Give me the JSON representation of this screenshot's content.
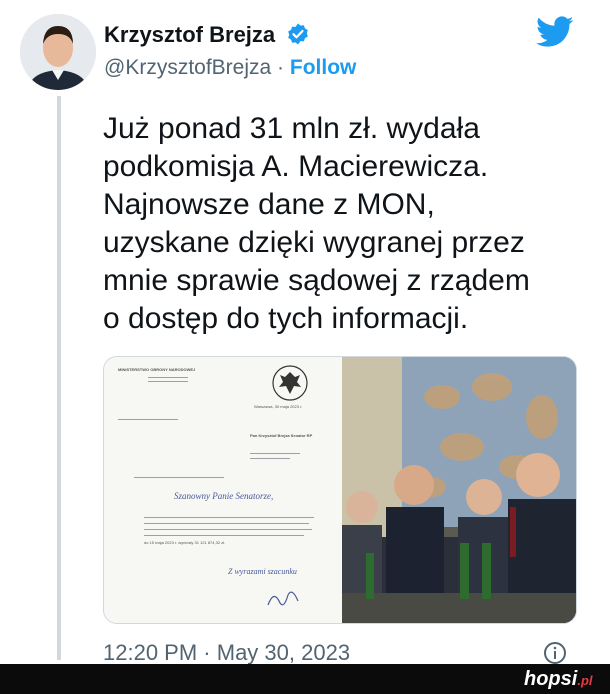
{
  "author": {
    "name": "Krzysztof Brejza",
    "handle": "@KrzysztofBrejza",
    "separator": "·",
    "follow_label": "Follow"
  },
  "tweet": {
    "text": "Już ponad 31 mln zł. wydała\npodkomisja A. Macierewicza.\nNajnowsze dane z MON,\nuzyskane dzięki wygranej przez\nmnie sprawie sądowej z rządem\no dostęp do tych informacji.",
    "time": "12:20 PM",
    "date_separator": "·",
    "date": "May 30, 2023"
  },
  "document": {
    "header": "MINISTERSTWO OBRONY NARODOWEJ",
    "city_date": "Warszawa, 30 maja 2023 r.",
    "recipient": "Pan Krzysztof Brejza Senator RP",
    "salutation": "Szanowny Panie Senatorze,",
    "amount_line": "do 15 maja 2023 r. wyniosły 31 121 874,32 zł.",
    "closing": "Z wyrazami szacunku"
  },
  "watermark": {
    "brand": "hopsi",
    "tld": ".pl"
  },
  "icons": [
    "verified-badge-icon",
    "twitter-bird-icon",
    "info-icon"
  ],
  "colors": {
    "accent": "#1d9bf0",
    "text": "#0f1419",
    "muted": "#536471",
    "thread_line": "#cfd9de"
  }
}
